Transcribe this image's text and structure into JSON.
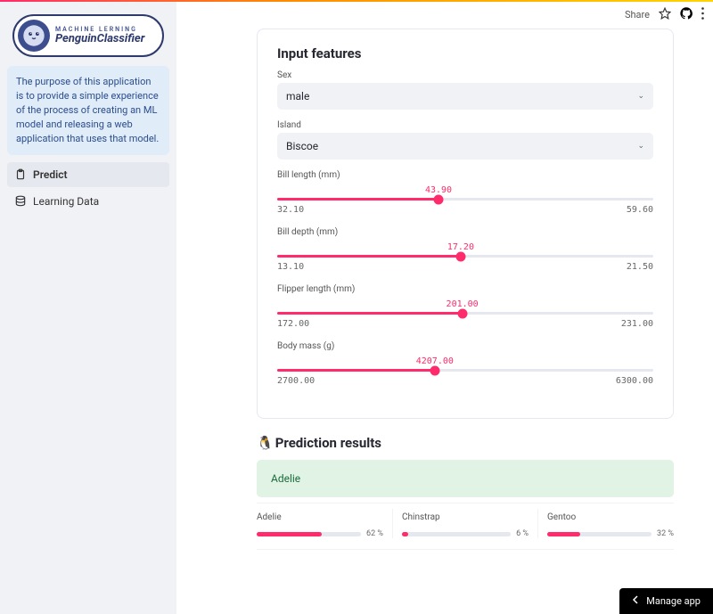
{
  "colors": {
    "accent": "#ff2b6b",
    "sidebar_bg": "#f0f2f6",
    "info_bg": "#e0ecf8",
    "success_bg": "#e0f3e4"
  },
  "topbar": {
    "share": "Share"
  },
  "logo": {
    "tagline": "MACHINE LERNING",
    "name": "PenguinClassifier"
  },
  "sidebar": {
    "description": "The purpose of this application is to provide a simple experience of the process of creating an ML model and releasing a web application that uses that model.",
    "nav": [
      {
        "label": "Predict",
        "icon": "clipboard",
        "selected": true
      },
      {
        "label": "Learning Data",
        "icon": "database",
        "selected": false
      }
    ]
  },
  "input_card": {
    "heading": "Input features",
    "selects": [
      {
        "label": "Sex",
        "value": "male"
      },
      {
        "label": "Island",
        "value": "Biscoe"
      }
    ],
    "sliders": [
      {
        "label": "Bill length (mm)",
        "min": "32.10",
        "max": "59.60",
        "value": "43.90",
        "pct": 42.9
      },
      {
        "label": "Bill depth (mm)",
        "min": "13.10",
        "max": "21.50",
        "value": "17.20",
        "pct": 48.8
      },
      {
        "label": "Flipper length (mm)",
        "min": "172.00",
        "max": "231.00",
        "value": "201.00",
        "pct": 49.2
      },
      {
        "label": "Body mass (g)",
        "min": "2700.00",
        "max": "6300.00",
        "value": "4207.00",
        "pct": 41.9
      }
    ]
  },
  "results": {
    "heading": "Prediction results",
    "penguin_emoji": "🐧",
    "predicted": "Adelie",
    "probs": [
      {
        "name": "Adelie",
        "pct": 62,
        "label": "62 %"
      },
      {
        "name": "Chinstrap",
        "pct": 6,
        "label": "6 %"
      },
      {
        "name": "Gentoo",
        "pct": 32,
        "label": "32 %"
      }
    ]
  },
  "footer": {
    "manage": "Manage app"
  }
}
